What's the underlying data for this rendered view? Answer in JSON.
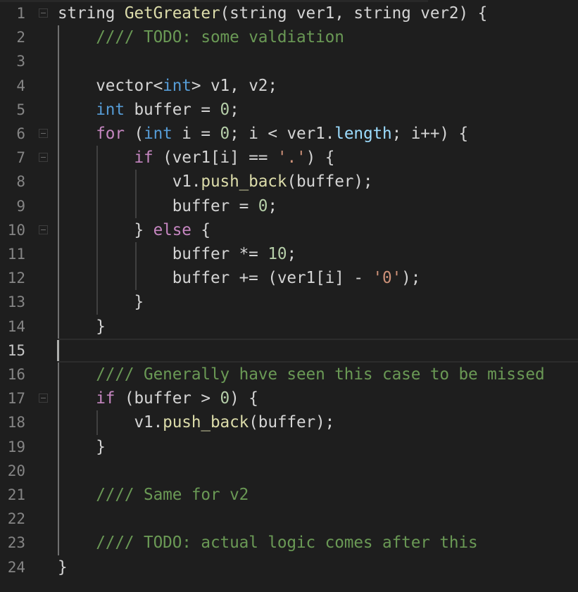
{
  "editor": {
    "language": "cpp",
    "current_line": 15,
    "colors": {
      "background": "#1e1e1e",
      "function": "#dcdcaa",
      "type_keyword": "#569cd6",
      "control_keyword": "#c586c0",
      "number": "#b5cea8",
      "comment": "#6a9955",
      "string": "#ce9178",
      "property": "#9cdcfe",
      "text": "#d4d4d4",
      "line_number": "#858585"
    },
    "lines": [
      {
        "n": "1",
        "fold": true,
        "tokens": [
          [
            "plain",
            "string "
          ],
          [
            "fn",
            "GetGreater"
          ],
          [
            "plain",
            "(string ver1, string ver2) {"
          ]
        ]
      },
      {
        "n": "2",
        "fold": false,
        "tokens": [
          [
            "plain",
            "    "
          ],
          [
            "cm",
            "//// TODO: some valdiation"
          ]
        ]
      },
      {
        "n": "3",
        "fold": false,
        "tokens": []
      },
      {
        "n": "4",
        "fold": false,
        "tokens": [
          [
            "plain",
            "    vector<"
          ],
          [
            "kw",
            "int"
          ],
          [
            "plain",
            "> v1, v2;"
          ]
        ]
      },
      {
        "n": "5",
        "fold": false,
        "tokens": [
          [
            "plain",
            "    "
          ],
          [
            "kw",
            "int"
          ],
          [
            "plain",
            " buffer = "
          ],
          [
            "num",
            "0"
          ],
          [
            "plain",
            ";"
          ]
        ]
      },
      {
        "n": "6",
        "fold": true,
        "tokens": [
          [
            "plain",
            "    "
          ],
          [
            "ctrl",
            "for"
          ],
          [
            "plain",
            " ("
          ],
          [
            "kw",
            "int"
          ],
          [
            "plain",
            " i = "
          ],
          [
            "num",
            "0"
          ],
          [
            "plain",
            "; i < ver1."
          ],
          [
            "prop",
            "length"
          ],
          [
            "plain",
            "; i++) {"
          ]
        ]
      },
      {
        "n": "7",
        "fold": true,
        "tokens": [
          [
            "plain",
            "        "
          ],
          [
            "ctrl",
            "if"
          ],
          [
            "plain",
            " (ver1[i] == "
          ],
          [
            "str",
            "'.'"
          ],
          [
            "plain",
            ") {"
          ]
        ]
      },
      {
        "n": "8",
        "fold": false,
        "tokens": [
          [
            "plain",
            "            v1."
          ],
          [
            "fn",
            "push_back"
          ],
          [
            "plain",
            "(buffer);"
          ]
        ]
      },
      {
        "n": "9",
        "fold": false,
        "tokens": [
          [
            "plain",
            "            buffer = "
          ],
          [
            "num",
            "0"
          ],
          [
            "plain",
            ";"
          ]
        ]
      },
      {
        "n": "10",
        "fold": true,
        "tokens": [
          [
            "plain",
            "        } "
          ],
          [
            "ctrl",
            "else"
          ],
          [
            "plain",
            " {"
          ]
        ]
      },
      {
        "n": "11",
        "fold": false,
        "tokens": [
          [
            "plain",
            "            buffer *= "
          ],
          [
            "num",
            "10"
          ],
          [
            "plain",
            ";"
          ]
        ]
      },
      {
        "n": "12",
        "fold": false,
        "tokens": [
          [
            "plain",
            "            buffer += (ver1[i] - "
          ],
          [
            "str",
            "'0'"
          ],
          [
            "plain",
            ");"
          ]
        ]
      },
      {
        "n": "13",
        "fold": false,
        "tokens": [
          [
            "plain",
            "        }"
          ]
        ]
      },
      {
        "n": "14",
        "fold": false,
        "tokens": [
          [
            "plain",
            "    }"
          ]
        ]
      },
      {
        "n": "15",
        "fold": false,
        "tokens": []
      },
      {
        "n": "16",
        "fold": false,
        "tokens": [
          [
            "plain",
            "    "
          ],
          [
            "cm",
            "//// Generally have seen this case to be missed"
          ]
        ]
      },
      {
        "n": "17",
        "fold": true,
        "tokens": [
          [
            "plain",
            "    "
          ],
          [
            "ctrl",
            "if"
          ],
          [
            "plain",
            " (buffer > "
          ],
          [
            "num",
            "0"
          ],
          [
            "plain",
            ") {"
          ]
        ]
      },
      {
        "n": "18",
        "fold": false,
        "tokens": [
          [
            "plain",
            "        v1."
          ],
          [
            "fn",
            "push_back"
          ],
          [
            "plain",
            "(buffer);"
          ]
        ]
      },
      {
        "n": "19",
        "fold": false,
        "tokens": [
          [
            "plain",
            "    }"
          ]
        ]
      },
      {
        "n": "20",
        "fold": false,
        "tokens": []
      },
      {
        "n": "21",
        "fold": false,
        "tokens": [
          [
            "plain",
            "    "
          ],
          [
            "cm",
            "//// Same for v2"
          ]
        ]
      },
      {
        "n": "22",
        "fold": false,
        "tokens": []
      },
      {
        "n": "23",
        "fold": false,
        "tokens": [
          [
            "plain",
            "    "
          ],
          [
            "cm",
            "//// TODO: actual logic comes after this"
          ]
        ]
      },
      {
        "n": "24",
        "fold": false,
        "tokens": [
          [
            "plain",
            "}"
          ]
        ]
      }
    ]
  }
}
